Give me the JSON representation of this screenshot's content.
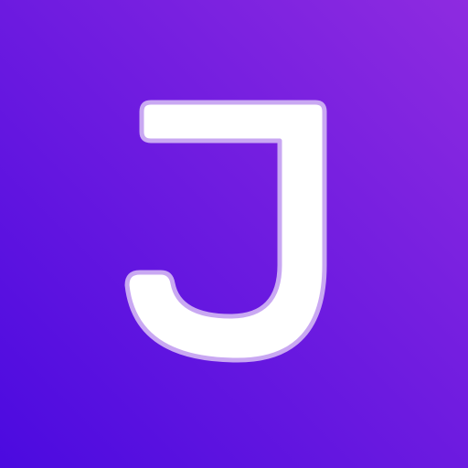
{
  "icon": {
    "name": "j-letter-icon",
    "letter": "J",
    "colors": {
      "gradient_start": "#4B0AE0",
      "gradient_end": "#8E2BE0",
      "letter_fill": "#FFFFFF",
      "letter_outline": "#C9A8F2"
    }
  }
}
